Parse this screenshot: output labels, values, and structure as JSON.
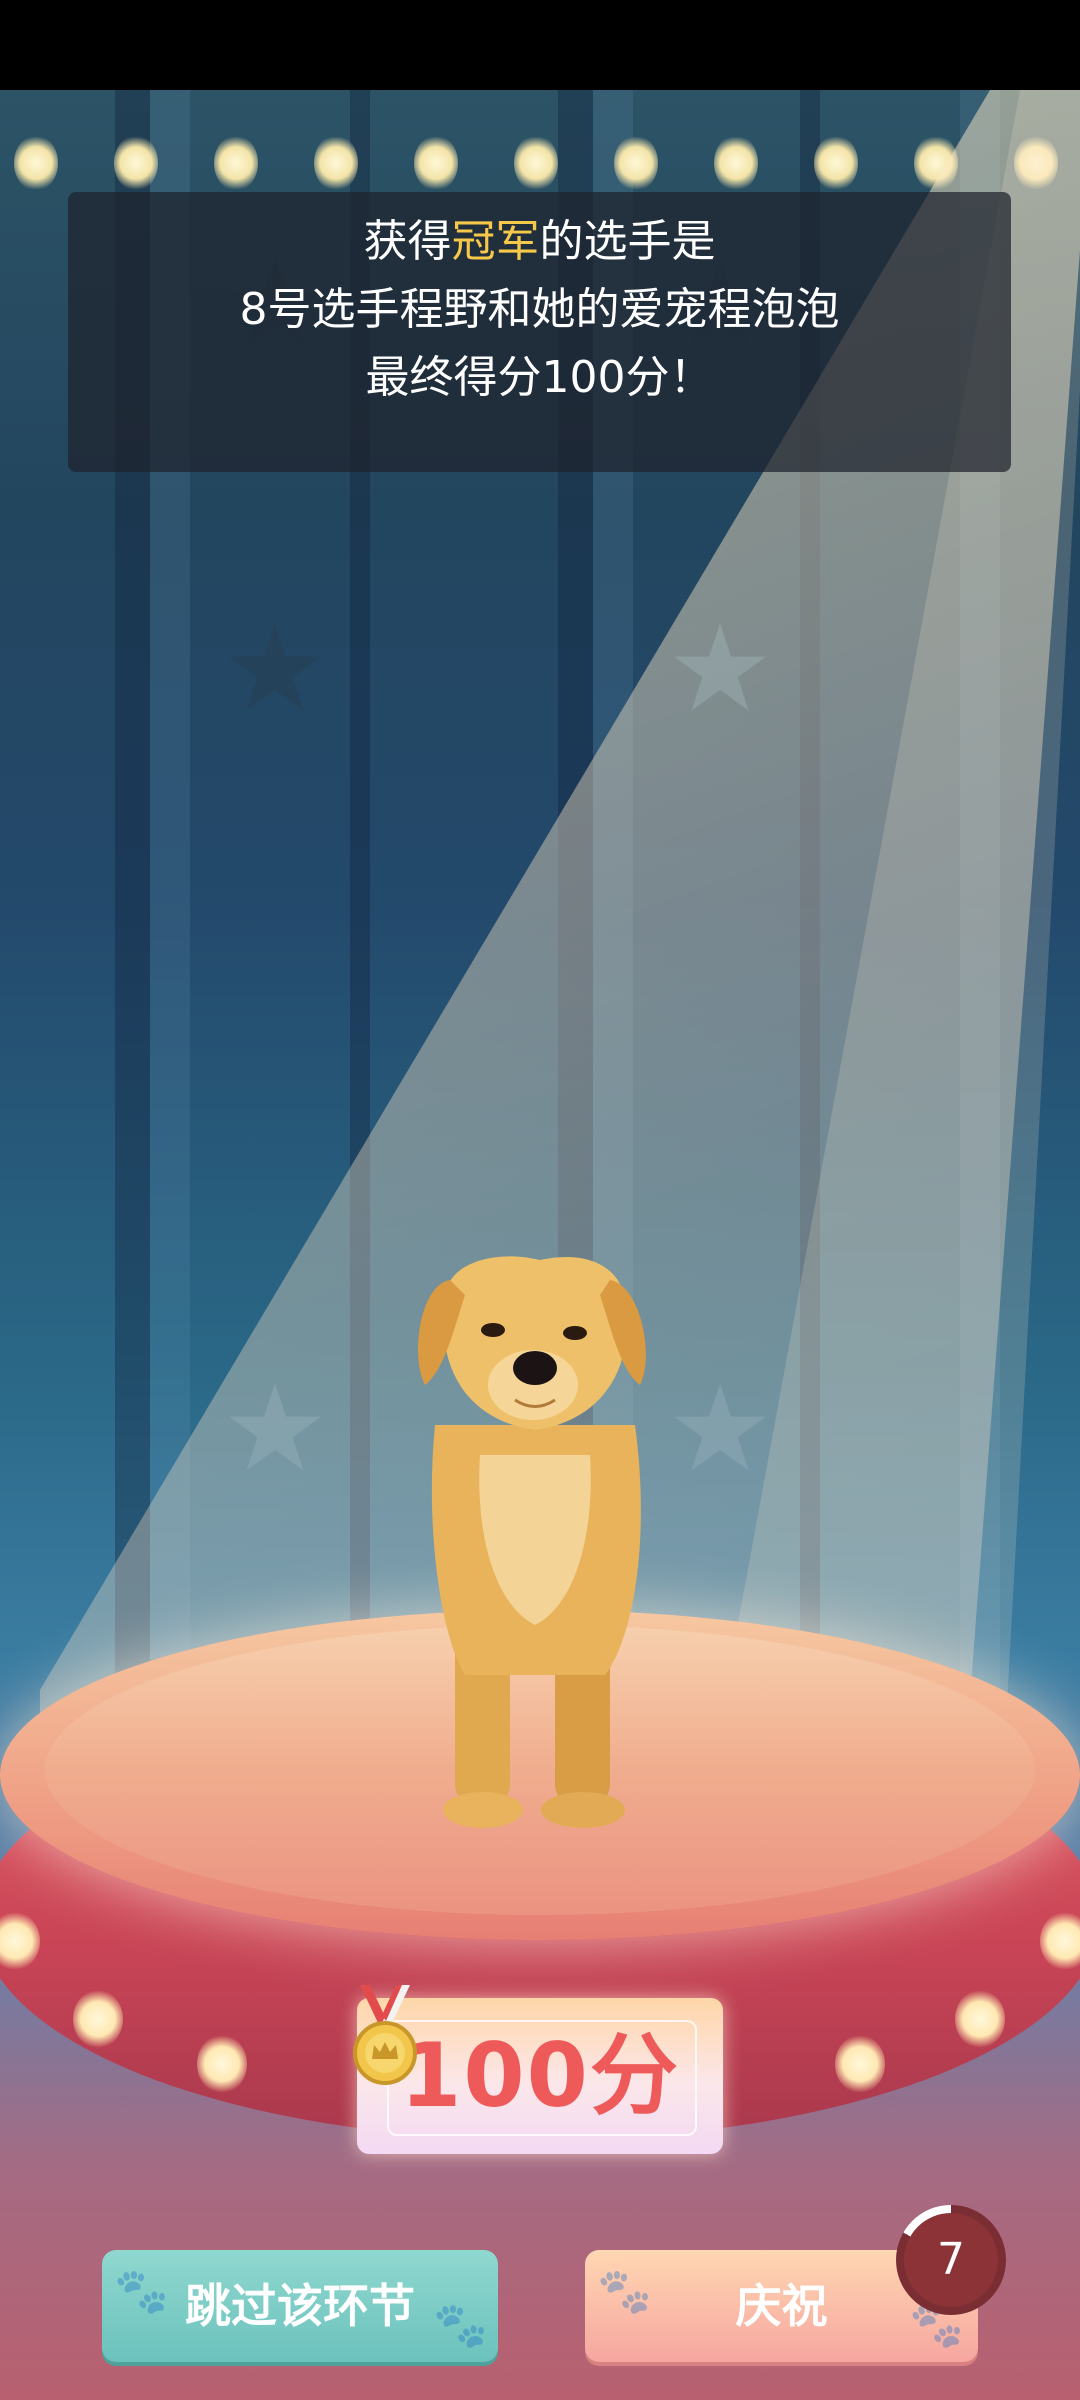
{
  "banner": {
    "line1_before": "获得",
    "line1_highlight": "冠军",
    "line1_after": "的选手是",
    "line2": "8号选手程野和她的爱宠程泡泡",
    "line3": "最终得分100分！"
  },
  "score": {
    "label": "100分"
  },
  "buttons": {
    "skip_label": "跳过该环节",
    "celebrate_label": "庆祝"
  },
  "countdown": {
    "value": "7"
  },
  "colors": {
    "highlight": "#f6c94b",
    "score_text": "#ee5a5a",
    "skip_button": "#7ccdc6",
    "celebrate_button": "#f9bfa8"
  },
  "icons": [
    "medal-icon",
    "star-icon",
    "paw-icon"
  ]
}
